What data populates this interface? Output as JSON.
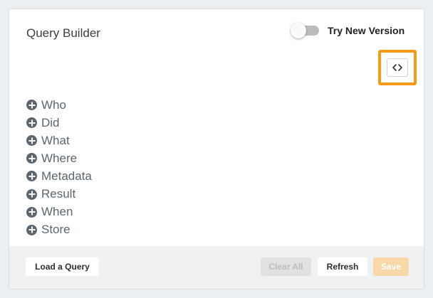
{
  "header": {
    "title": "Query Builder",
    "toggle": {
      "label": "Try New Version",
      "checked": false
    }
  },
  "toolbar": {
    "code_button_icon": "code-icon",
    "highlight_color": "#f59b1c"
  },
  "criteria": [
    {
      "label": "Who"
    },
    {
      "label": "Did"
    },
    {
      "label": "What"
    },
    {
      "label": "Where"
    },
    {
      "label": "Metadata"
    },
    {
      "label": "Result"
    },
    {
      "label": "When"
    },
    {
      "label": "Store"
    }
  ],
  "footer": {
    "load_label": "Load a Query",
    "clear_label": "Clear All",
    "refresh_label": "Refresh",
    "save_label": "Save"
  }
}
